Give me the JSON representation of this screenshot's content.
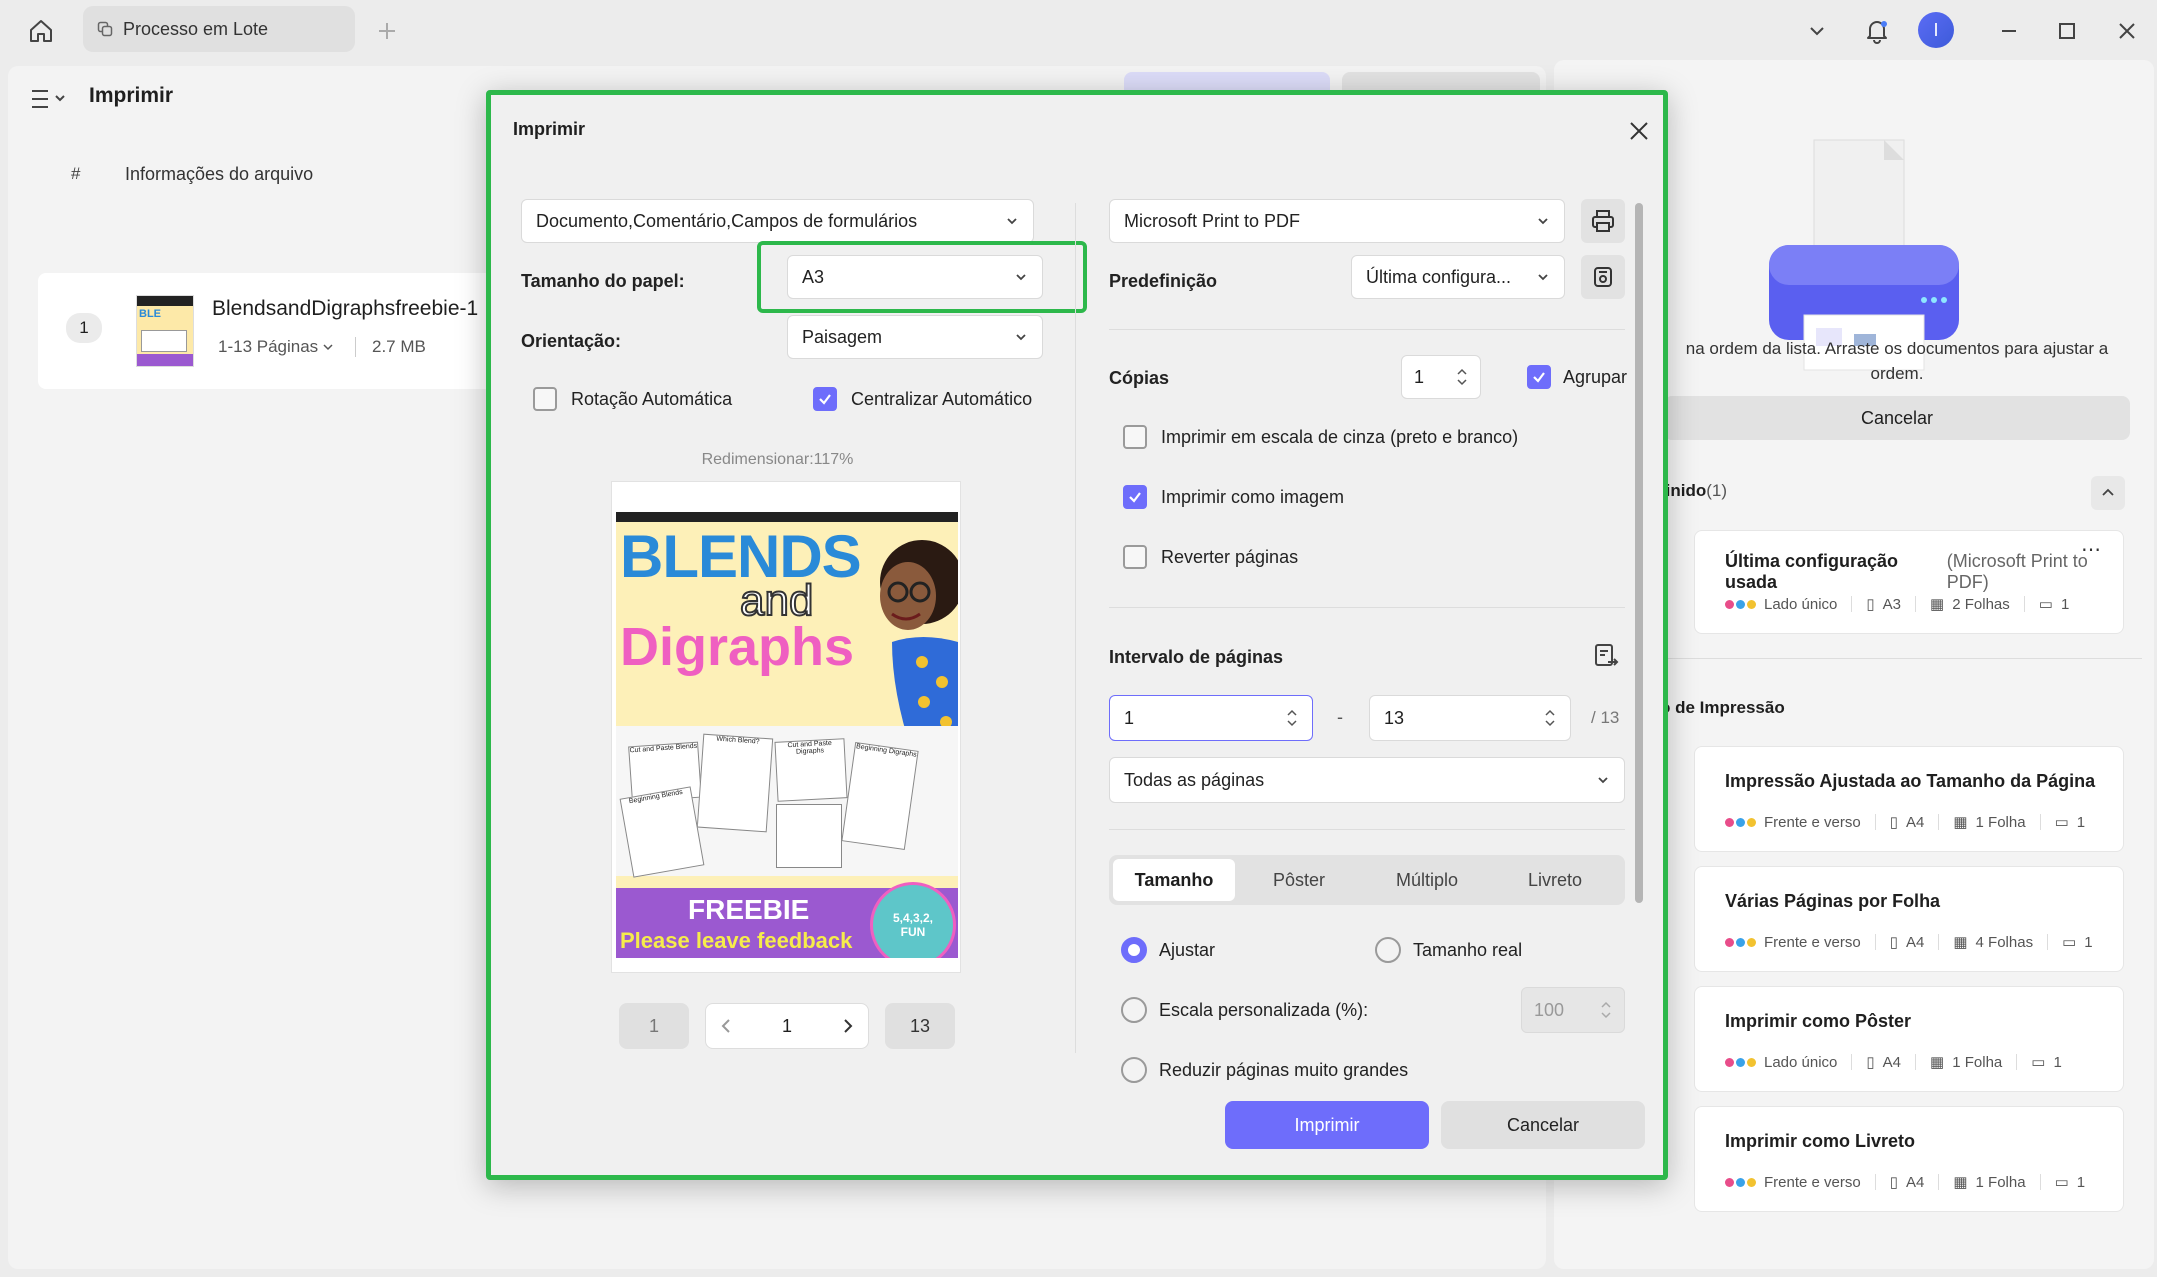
{
  "topbar": {
    "tab_title": "Processo em Lote",
    "avatar_initial": "I"
  },
  "left": {
    "title": "Imprimir",
    "col_num": "#",
    "col_info": "Informações do arquivo",
    "file": {
      "index": "1",
      "name": "BlendsandDigraphsfreebie-1",
      "pages": "1-13 Páginas",
      "size": "2.7 MB"
    }
  },
  "right": {
    "hint": "na ordem da lista. Arraste os documentos para ajustar a ordem.",
    "cancel": "Cancelar",
    "section_custom": "finido",
    "section_custom_count": "(1)",
    "last_title": "Última configuração usada",
    "last_printer": "(Microsoft Print to PDF)",
    "last_meta": [
      "Lado único",
      "A3",
      "2 Folhas",
      "1"
    ],
    "section_modes": "o de Impressão",
    "presets": [
      {
        "title": "Impressão Ajustada ao Tamanho da Página",
        "meta": [
          "Frente e verso",
          "A4",
          "1 Folha",
          "1"
        ]
      },
      {
        "title": "Várias Páginas por Folha",
        "meta": [
          "Frente e verso",
          "A4",
          "4 Folhas",
          "1"
        ]
      },
      {
        "title": "Imprimir como Pôster",
        "meta": [
          "Lado único",
          "A4",
          "1 Folha",
          "1"
        ]
      },
      {
        "title": "Imprimir como Livreto",
        "meta": [
          "Frente e verso",
          "A4",
          "1 Folha",
          "1"
        ]
      }
    ]
  },
  "dialog": {
    "title": "Imprimir",
    "content_select": "Documento,Comentário,Campos de formulários",
    "paper_size_label": "Tamanho do papel:",
    "paper_size": "A3",
    "orientation_label": "Orientação:",
    "orientation": "Paisagem",
    "auto_rotate": "Rotação Automática",
    "auto_center": "Centralizar Automático",
    "resize": "Redimensionar:117%",
    "page_first": "1",
    "page_current": "1",
    "page_last": "13",
    "printer": "Microsoft Print to PDF",
    "preset_label": "Predefinição",
    "preset_value": "Última configura...",
    "copies_label": "Cópias",
    "copies": "1",
    "collate": "Agrupar",
    "grayscale": "Imprimir em escala de cinza (preto e branco)",
    "as_image": "Imprimir como imagem",
    "reverse": "Reverter páginas",
    "range_label": "Intervalo de páginas",
    "range_from": "1",
    "range_dash": "-",
    "range_to": "13",
    "range_total": "/ 13",
    "range_mode": "Todas as páginas",
    "tabs": [
      "Tamanho",
      "Pôster",
      "Múltiplo",
      "Livreto"
    ],
    "fit": "Ajustar",
    "actual": "Tamanho real",
    "custom_scale": "Escala personalizada (%):",
    "scale_value": "100",
    "shrink": "Reduzir páginas muito grandes",
    "print_button": "Imprimir",
    "cancel_button": "Cancelar"
  },
  "thumbnail": {
    "line1": "BLENDS",
    "line2": "and",
    "line3": "Digraphs",
    "ws1": "Cut and Paste Blends",
    "ws2": "Which Blend?",
    "ws3": "Cut and Paste Digraphs",
    "ws4": "Beginning Digraphs",
    "ws5": "Beginning Blends",
    "freebie": "FREEBIE",
    "feedback": "Please leave feedback",
    "badge": "5,4,3,2, FUN"
  },
  "colors": {
    "accent": "#6e6dfb",
    "highlight": "#2db84b"
  }
}
